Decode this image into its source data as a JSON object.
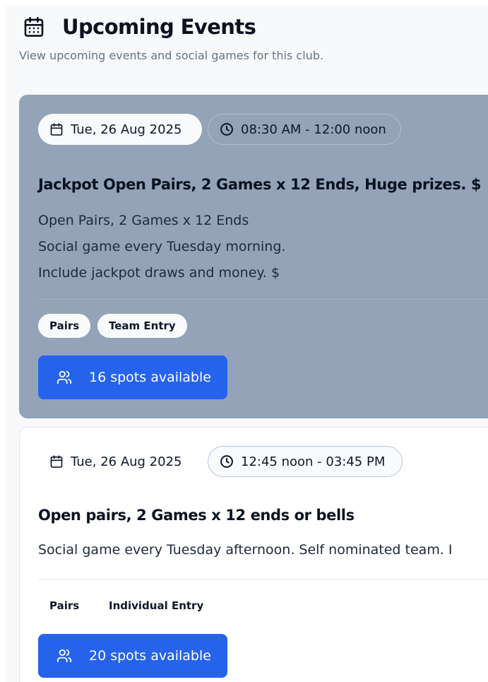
{
  "header": {
    "title": "Upcoming Events",
    "subtitle": "View upcoming events and social games for this club."
  },
  "events": [
    {
      "date": "Tue, 26 Aug 2025",
      "time": "08:30 AM - 12:00 noon",
      "title": "Jackpot Open Pairs, 2 Games x 12 Ends, Huge prizes. $",
      "description": [
        "Open Pairs, 2 Games x 12 Ends",
        "Social game every Tuesday morning.",
        "Include jackpot draws and money. $"
      ],
      "tags": [
        "Pairs",
        "Team Entry"
      ],
      "spots": "16 spots available",
      "highlighted": true
    },
    {
      "date": "Tue, 26 Aug 2025",
      "time": "12:45 noon - 03:45 PM",
      "title": "Open pairs, 2 Games x 12 ends or bells",
      "description": [
        "Social game every Tuesday afternoon. Self nominated team. I"
      ],
      "tags": [
        "Pairs",
        "Individual Entry"
      ],
      "spots": "20 spots available",
      "highlighted": false
    }
  ],
  "colors": {
    "accent": "#2563eb",
    "highlight_card": "#94a3b8",
    "text_muted": "#64748b"
  },
  "icons": {
    "title": "calendar-icon",
    "date": "calendar-icon",
    "time": "clock-icon",
    "spots": "users-icon"
  }
}
